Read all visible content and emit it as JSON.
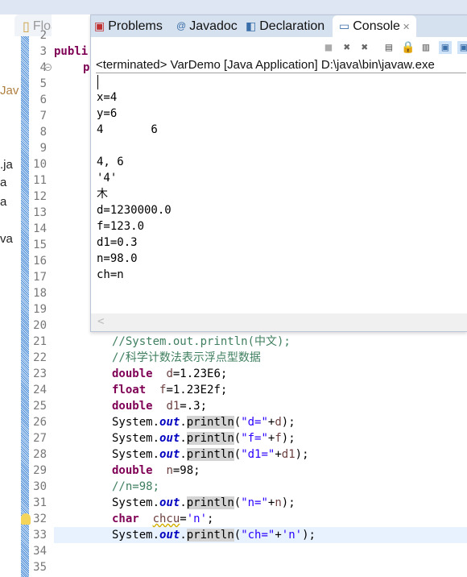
{
  "left_panel": {
    "fragments": [
      "Jav",
      ".ja",
      "a",
      "a",
      "va"
    ]
  },
  "editor": {
    "tab_label": "FloatDem",
    "line_numbers": [
      "2",
      "3",
      "4",
      "5",
      "6",
      "7",
      "8",
      "9",
      "10",
      "11",
      "12",
      "13",
      "14",
      "15",
      "16",
      "17",
      "18",
      "19",
      "20",
      "21",
      "22",
      "23",
      "24",
      "25",
      "26",
      "27",
      "28",
      "29",
      "30",
      "31",
      "32",
      "33",
      "34",
      "35"
    ],
    "line3": "publi",
    "line4": "p",
    "code": [
      {
        "n": 21,
        "parts": [
          [
            "cm",
            "//System.out.println(中文);"
          ]
        ]
      },
      {
        "n": 22,
        "parts": [
          [
            "cm",
            "//科学计数法表示浮点型数据"
          ]
        ]
      },
      {
        "n": 23,
        "parts": [
          [
            "kw",
            "double"
          ],
          [
            "",
            "  "
          ],
          [
            "var",
            "d"
          ],
          [
            "",
            "=1.23E6;"
          ]
        ]
      },
      {
        "n": 24,
        "parts": [
          [
            "kw",
            "float"
          ],
          [
            "",
            "  "
          ],
          [
            "var",
            "f"
          ],
          [
            "",
            "=1.23E2f;"
          ]
        ]
      },
      {
        "n": 25,
        "parts": [
          [
            "kw",
            "double"
          ],
          [
            "",
            "  "
          ],
          [
            "var",
            "d1"
          ],
          [
            "",
            "=.3;"
          ]
        ]
      },
      {
        "n": 26,
        "parts": [
          [
            "",
            "System."
          ],
          [
            "fld",
            "out"
          ],
          [
            "",
            "."
          ],
          [
            "occ",
            "println"
          ],
          [
            "",
            "("
          ],
          [
            "st",
            "\"d=\""
          ],
          [
            "",
            "+"
          ],
          [
            "var",
            "d"
          ],
          [
            "",
            ");"
          ]
        ]
      },
      {
        "n": 27,
        "parts": [
          [
            "",
            "System."
          ],
          [
            "fld",
            "out"
          ],
          [
            "",
            "."
          ],
          [
            "occ",
            "println"
          ],
          [
            "",
            "("
          ],
          [
            "st",
            "\"f=\""
          ],
          [
            "",
            "+"
          ],
          [
            "var",
            "f"
          ],
          [
            "",
            ");"
          ]
        ]
      },
      {
        "n": 28,
        "parts": [
          [
            "",
            "System."
          ],
          [
            "fld",
            "out"
          ],
          [
            "",
            "."
          ],
          [
            "occ",
            "println"
          ],
          [
            "",
            "("
          ],
          [
            "st",
            "\"d1=\""
          ],
          [
            "",
            "+"
          ],
          [
            "var",
            "d1"
          ],
          [
            "",
            ");"
          ]
        ]
      },
      {
        "n": 29,
        "parts": [
          [
            "kw",
            "double"
          ],
          [
            "",
            "  "
          ],
          [
            "var",
            "n"
          ],
          [
            "",
            "=98;"
          ]
        ]
      },
      {
        "n": 30,
        "parts": [
          [
            "cm",
            "//n=98;"
          ]
        ]
      },
      {
        "n": 31,
        "parts": [
          [
            "",
            "System."
          ],
          [
            "fld",
            "out"
          ],
          [
            "",
            "."
          ],
          [
            "occ",
            "println"
          ],
          [
            "",
            "("
          ],
          [
            "st",
            "\"n=\""
          ],
          [
            "",
            "+"
          ],
          [
            "var",
            "n"
          ],
          [
            "",
            ");"
          ]
        ]
      },
      {
        "n": 32,
        "parts": [
          [
            "kw",
            "char"
          ],
          [
            "",
            "  "
          ],
          [
            "warn",
            "chcu"
          ],
          [
            "",
            "="
          ],
          [
            "st",
            "'n'"
          ],
          [
            "",
            ";"
          ]
        ]
      },
      {
        "n": 33,
        "parts": [
          [
            "",
            "System."
          ],
          [
            "fld",
            "out"
          ],
          [
            "",
            "."
          ],
          [
            "occ",
            "println"
          ],
          [
            "",
            "("
          ],
          [
            "st",
            "\"ch=\""
          ],
          [
            "",
            "+"
          ],
          [
            "st",
            "'n'"
          ],
          [
            "",
            ");"
          ]
        ]
      }
    ],
    "warning_line": 32,
    "current_line": 33
  },
  "console_view": {
    "tabs": [
      {
        "label": "Problems",
        "icon": "problems-icon"
      },
      {
        "label": "Javadoc",
        "icon": "at-icon"
      },
      {
        "label": "Declaration",
        "icon": "declaration-icon"
      },
      {
        "label": "Console",
        "icon": "console-icon",
        "active": true
      }
    ],
    "toolbar": [
      "terminate-icon",
      "remove-launch-icon",
      "remove-all-icon",
      "clear-console-icon",
      "scroll-lock-icon",
      "word-wrap-icon",
      "pin-console-icon",
      "display-selected-console-icon"
    ],
    "status": "<terminated> VarDemo [Java Application] D:\\java\\bin\\javaw.exe",
    "output": [
      "x=4",
      "y=6",
      "4       6",
      "",
      "4, 6",
      "'4'",
      "木",
      "d=1230000.0",
      "f=123.0",
      "d1=0.3",
      "n=98.0",
      "ch=n"
    ]
  }
}
